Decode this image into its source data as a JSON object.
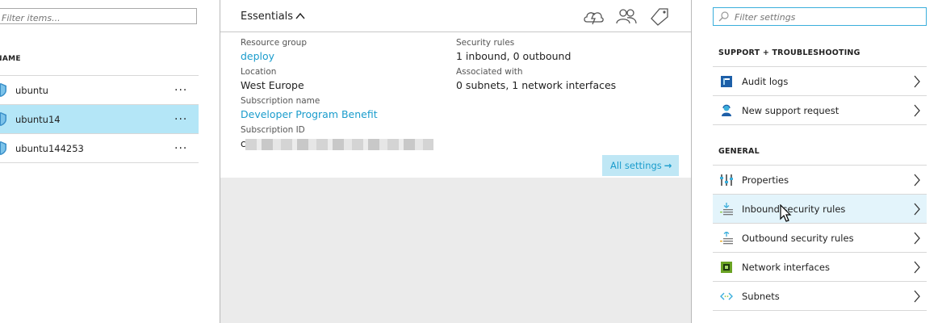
{
  "left_blade": {
    "filter_placeholder": "Filter items...",
    "column_header": "NAME",
    "items": [
      {
        "name": "ubuntu",
        "more": "...",
        "selected": false
      },
      {
        "name": "ubuntu14",
        "more": "...",
        "selected": true
      },
      {
        "name": "ubuntu144253",
        "more": "...",
        "selected": false
      }
    ]
  },
  "essentials": {
    "title": "Essentials",
    "toolbar_icons": [
      "cloud-settings-icon",
      "users-icon",
      "tag-icon"
    ],
    "fields_left": [
      {
        "label": "Resource group",
        "value": "deploy",
        "is_link": true
      },
      {
        "label": "Location",
        "value": "West Europe",
        "is_link": false
      },
      {
        "label": "Subscription name",
        "value": "Developer Program Benefit",
        "is_link": true
      },
      {
        "label": "Subscription ID",
        "value": "c",
        "is_link": false
      }
    ],
    "fields_right": [
      {
        "label": "Security rules",
        "value": "1 inbound, 0 outbound"
      },
      {
        "label": "Associated with",
        "value": "0 subnets, 1 network interfaces"
      }
    ],
    "all_settings_label": "All settings",
    "all_settings_arrow": "→"
  },
  "settings": {
    "search_placeholder": "Filter settings",
    "sections": [
      {
        "title": "SUPPORT + TROUBLESHOOTING",
        "items": [
          {
            "label": "Audit logs",
            "icon": "audit-log-icon"
          },
          {
            "label": "New support request",
            "icon": "support-person-icon"
          }
        ]
      },
      {
        "title": "GENERAL",
        "items": [
          {
            "label": "Properties",
            "icon": "properties-icon"
          },
          {
            "label": "Inbound security rules",
            "icon": "inbound-rules-icon"
          },
          {
            "label": "Outbound security rules",
            "icon": "outbound-rules-icon"
          },
          {
            "label": "Network interfaces",
            "icon": "network-interface-icon"
          },
          {
            "label": "Subnets",
            "icon": "subnets-icon"
          }
        ]
      }
    ]
  },
  "colors": {
    "accent": "#1a9ccc",
    "selected_row": "#b4e6f7",
    "hover_row": "#e3f4fb",
    "button_bg": "#bfe7f5"
  }
}
